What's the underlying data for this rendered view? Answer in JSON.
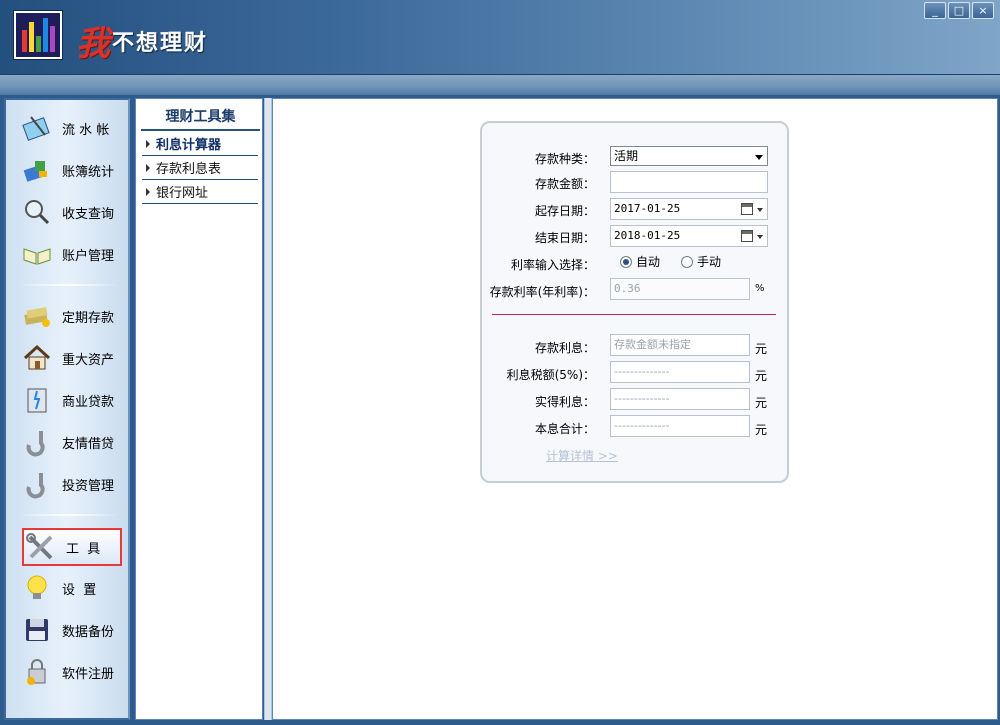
{
  "app": {
    "title_big": "我",
    "title_rest": "不想理财",
    "window_controls": [
      "_",
      "□",
      "×"
    ]
  },
  "nav": {
    "items": [
      {
        "label": "流 水 帐",
        "icon": "notebook-pen-icon"
      },
      {
        "label": "账簿统计",
        "icon": "book-chart-icon"
      },
      {
        "label": "收支查询",
        "icon": "magnifier-icon"
      },
      {
        "label": "账户管理",
        "icon": "open-book-icon"
      },
      {
        "label": "定期存款",
        "icon": "money-stack-icon"
      },
      {
        "label": "重大资产",
        "icon": "house-icon"
      },
      {
        "label": "商业贷款",
        "icon": "door-icon"
      },
      {
        "label": "友情借贷",
        "icon": "hook-icon"
      },
      {
        "label": "投资管理",
        "icon": "hook-icon"
      },
      {
        "label": "工  具",
        "icon": "tools-icon"
      },
      {
        "label": "设  置",
        "icon": "lightbulb-icon"
      },
      {
        "label": "数据备份",
        "icon": "floppy-disk-icon"
      },
      {
        "label": "软件注册",
        "icon": "lock-key-icon"
      }
    ],
    "active_index": 9
  },
  "tools": {
    "header": "理财工具集",
    "items": [
      {
        "label": "利息计算器",
        "selected": true
      },
      {
        "label": "存款利息表",
        "selected": false
      },
      {
        "label": "银行网址",
        "selected": false
      }
    ]
  },
  "calculator": {
    "deposit_type": {
      "label": "存款种类：",
      "value": "活期"
    },
    "amount": {
      "label": "存款金额：",
      "value": ""
    },
    "start_date": {
      "label": "起存日期：",
      "value": "2017-01-25"
    },
    "end_date": {
      "label": "结束日期：",
      "value": "2018-01-25"
    },
    "rate_choice": {
      "label": "利率输入选择：",
      "auto": "自动",
      "manual": "手动",
      "selected": "auto"
    },
    "rate": {
      "label": "存款利率(年利率)：",
      "value": "0.36",
      "unit": "%"
    },
    "interest": {
      "label": "存款利息：",
      "value": "存款金额未指定",
      "unit": "元"
    },
    "tax": {
      "label": "利息税额(5%)：",
      "value": "--------------",
      "unit": "元"
    },
    "net_interest": {
      "label": "实得利息：",
      "value": "--------------",
      "unit": "元"
    },
    "total": {
      "label": "本息合计：",
      "value": "--------------",
      "unit": "元"
    },
    "detail_link": "计算详情 >>"
  },
  "colors": {
    "header_dark": "#24507f",
    "accent_red": "#e8393a",
    "divider_red": "#c0264b"
  }
}
